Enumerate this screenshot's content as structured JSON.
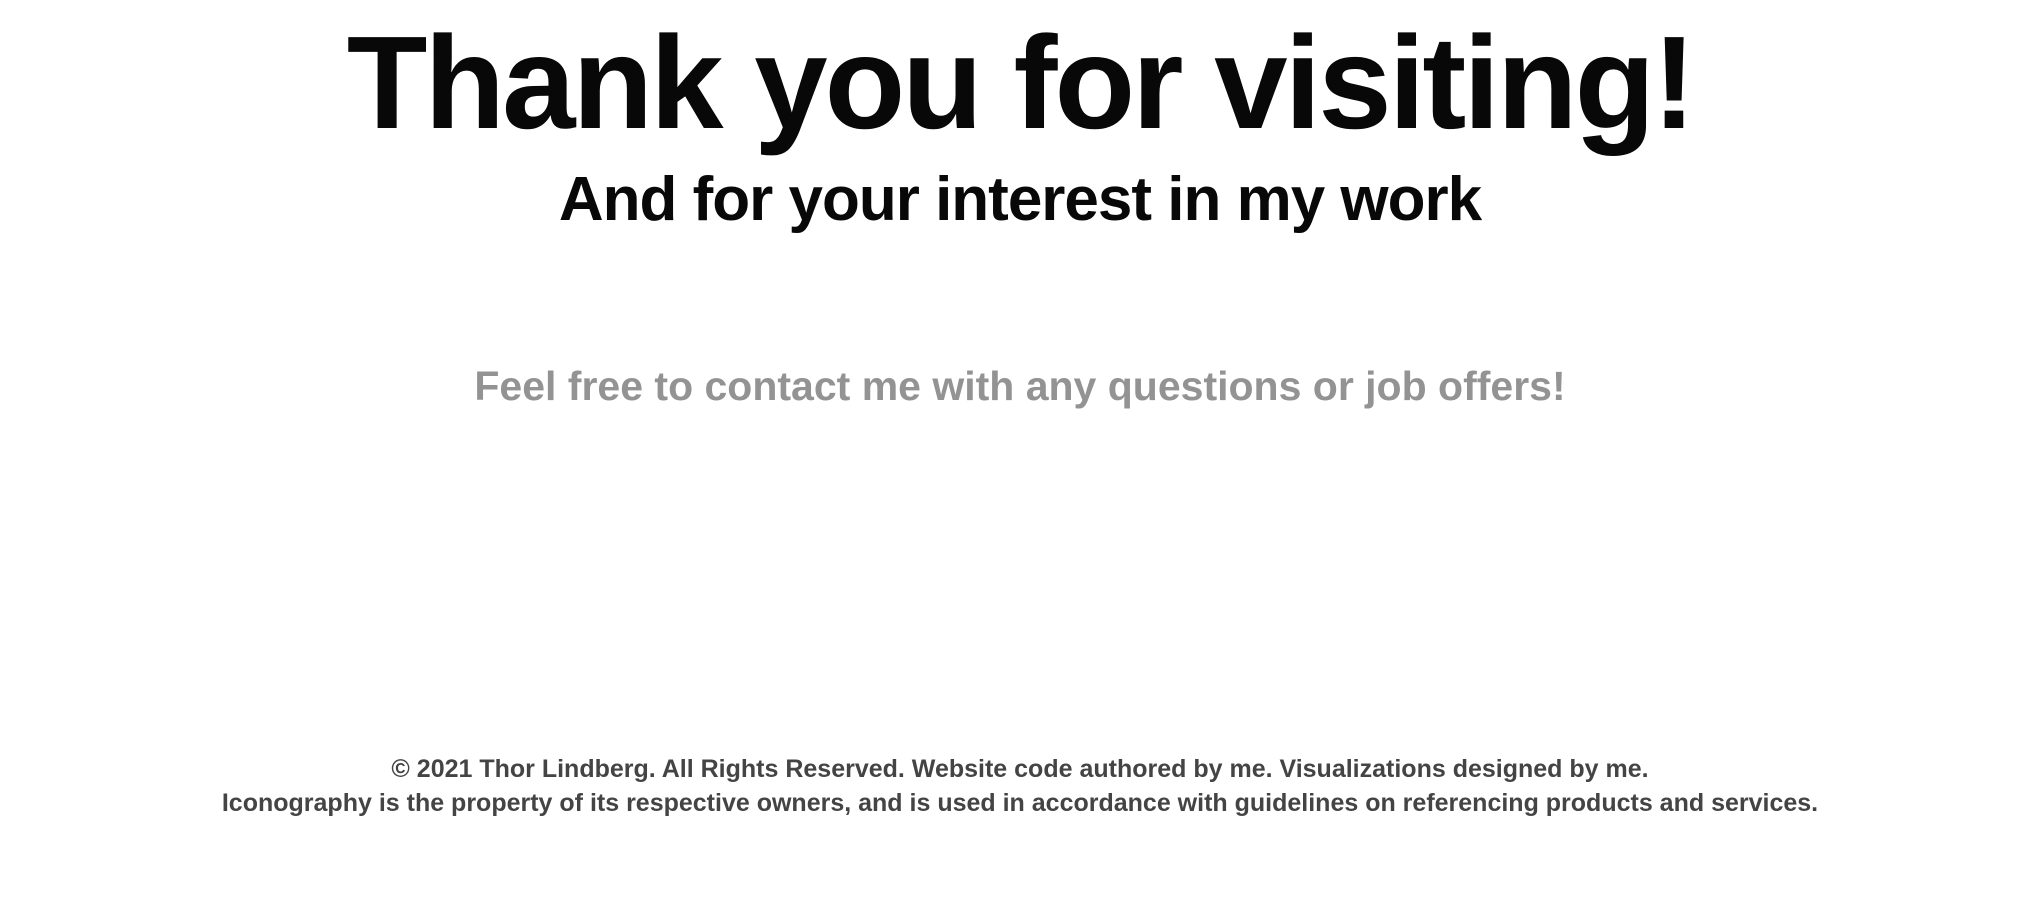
{
  "hero": {
    "title": "Thank you for visiting!",
    "subtitle": "And for your interest in my work"
  },
  "contact": {
    "text": "Feel free to contact me with any questions or job offers!"
  },
  "footer": {
    "copyright": "© 2021 Thor Lindberg. All Rights Reserved. Website code authored by me. Visualizations designed by me.",
    "iconography": "Iconography is the property of its respective owners, and is used in accordance with guidelines on referencing products and services."
  },
  "colors": {
    "background": "#ffffff",
    "heading": "#080808",
    "muted": "#939393",
    "footer_text": "#444444"
  }
}
